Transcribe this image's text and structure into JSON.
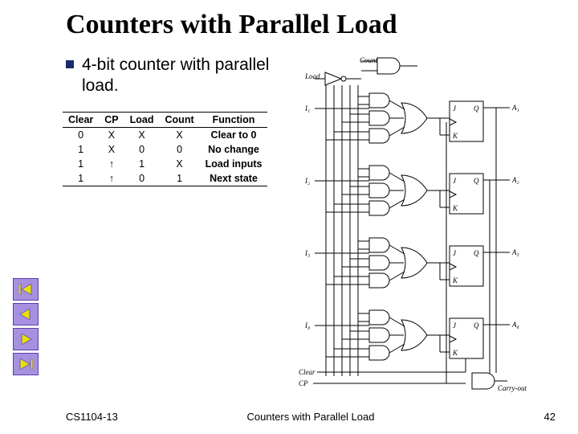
{
  "title": "Counters with Parallel Load",
  "bullet": "4-bit counter with parallel load.",
  "table": {
    "headers": [
      "Clear",
      "CP",
      "Load",
      "Count",
      "Function"
    ],
    "rows": [
      [
        "0",
        "X",
        "X",
        "X",
        "Clear to 0"
      ],
      [
        "1",
        "X",
        "0",
        "0",
        "No change"
      ],
      [
        "1",
        "↑",
        "1",
        "X",
        "Load inputs"
      ],
      [
        "1",
        "↑",
        "0",
        "1",
        "Next state"
      ]
    ]
  },
  "circuit_labels": {
    "count": "Count",
    "load": "Load",
    "inputs": [
      "I₁",
      "I₂",
      "I₃",
      "I₄"
    ],
    "outputs": [
      "A₁",
      "A₂",
      "A₃",
      "A₄"
    ],
    "ff": [
      "J",
      "K",
      "Q"
    ],
    "clear": "Clear",
    "cp": "CP",
    "carry": "Carry-out"
  },
  "footer": {
    "left": "CS1104-13",
    "center": "Counters with Parallel Load",
    "right": "42"
  },
  "nav": {
    "first": "nav-first",
    "prev": "nav-prev",
    "next": "nav-next",
    "last": "nav-last"
  }
}
